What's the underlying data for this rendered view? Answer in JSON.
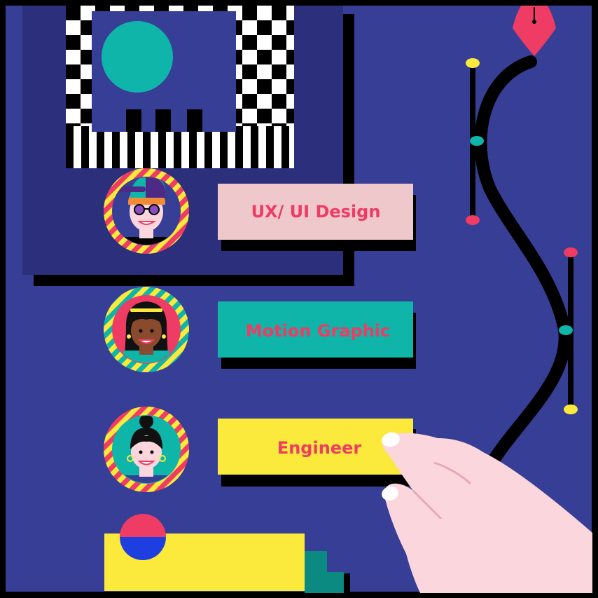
{
  "roles": [
    {
      "label": "UX/ UI Design",
      "card_color": "#efc8cc",
      "text_color": "#ee3c64"
    },
    {
      "label": "Motion Graphic",
      "card_color": "#10b5aa",
      "text_color": "#ee3c64"
    },
    {
      "label": "Engineer",
      "card_color": "#fbe93b",
      "text_color": "#ee3c64"
    }
  ],
  "colors": {
    "background": "#373e95",
    "panel": "#2c2f7c",
    "accent_pink": "#ee3c64",
    "accent_teal": "#10b5aa",
    "accent_yellow": "#fbe93b",
    "skin": "#fbd6dc"
  },
  "icons": [
    "checkerboard-artwork",
    "avatar-hipster",
    "avatar-woman-bangs",
    "avatar-woman-bun",
    "pen-nib-icon",
    "bezier-curve",
    "pointing-hand"
  ]
}
